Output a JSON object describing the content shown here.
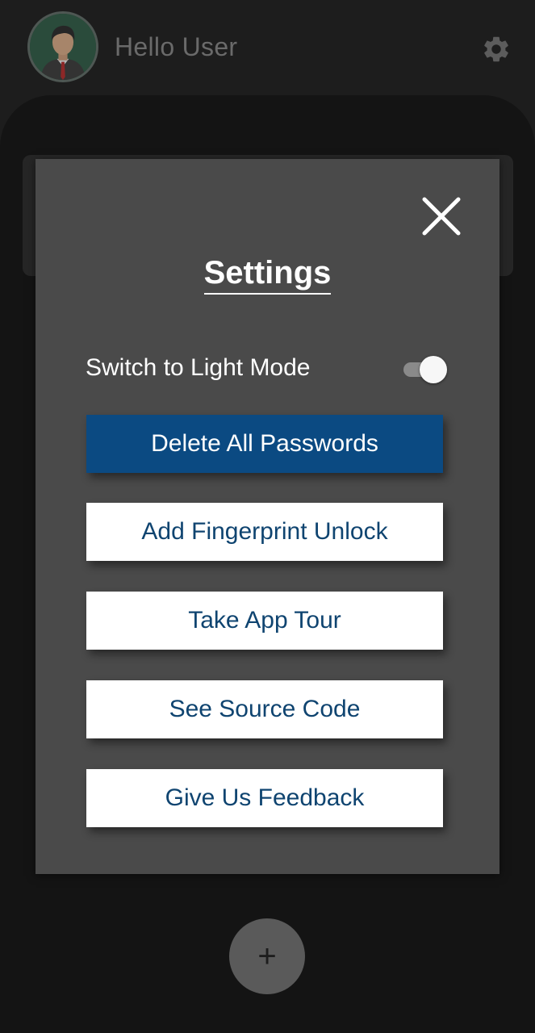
{
  "header": {
    "greeting": "Hello User",
    "avatar_icon": "user-avatar-icon",
    "settings_icon": "gear-icon"
  },
  "settings_modal": {
    "title": "Settings",
    "close_icon": "close-icon",
    "theme_toggle": {
      "label": "Switch to Light Mode",
      "checked": true
    },
    "buttons": {
      "delete_all": "Delete All Passwords",
      "fingerprint": "Add Fingerprint Unlock",
      "tour": "Take App Tour",
      "source_code": "See Source Code",
      "feedback": "Give Us Feedback"
    }
  },
  "fab": {
    "label": "+"
  },
  "colors": {
    "danger_button": "#0b4a82",
    "button_text": "#0f4470",
    "modal_bg": "#4a4a4a",
    "app_bg": "#1d1d1d"
  }
}
